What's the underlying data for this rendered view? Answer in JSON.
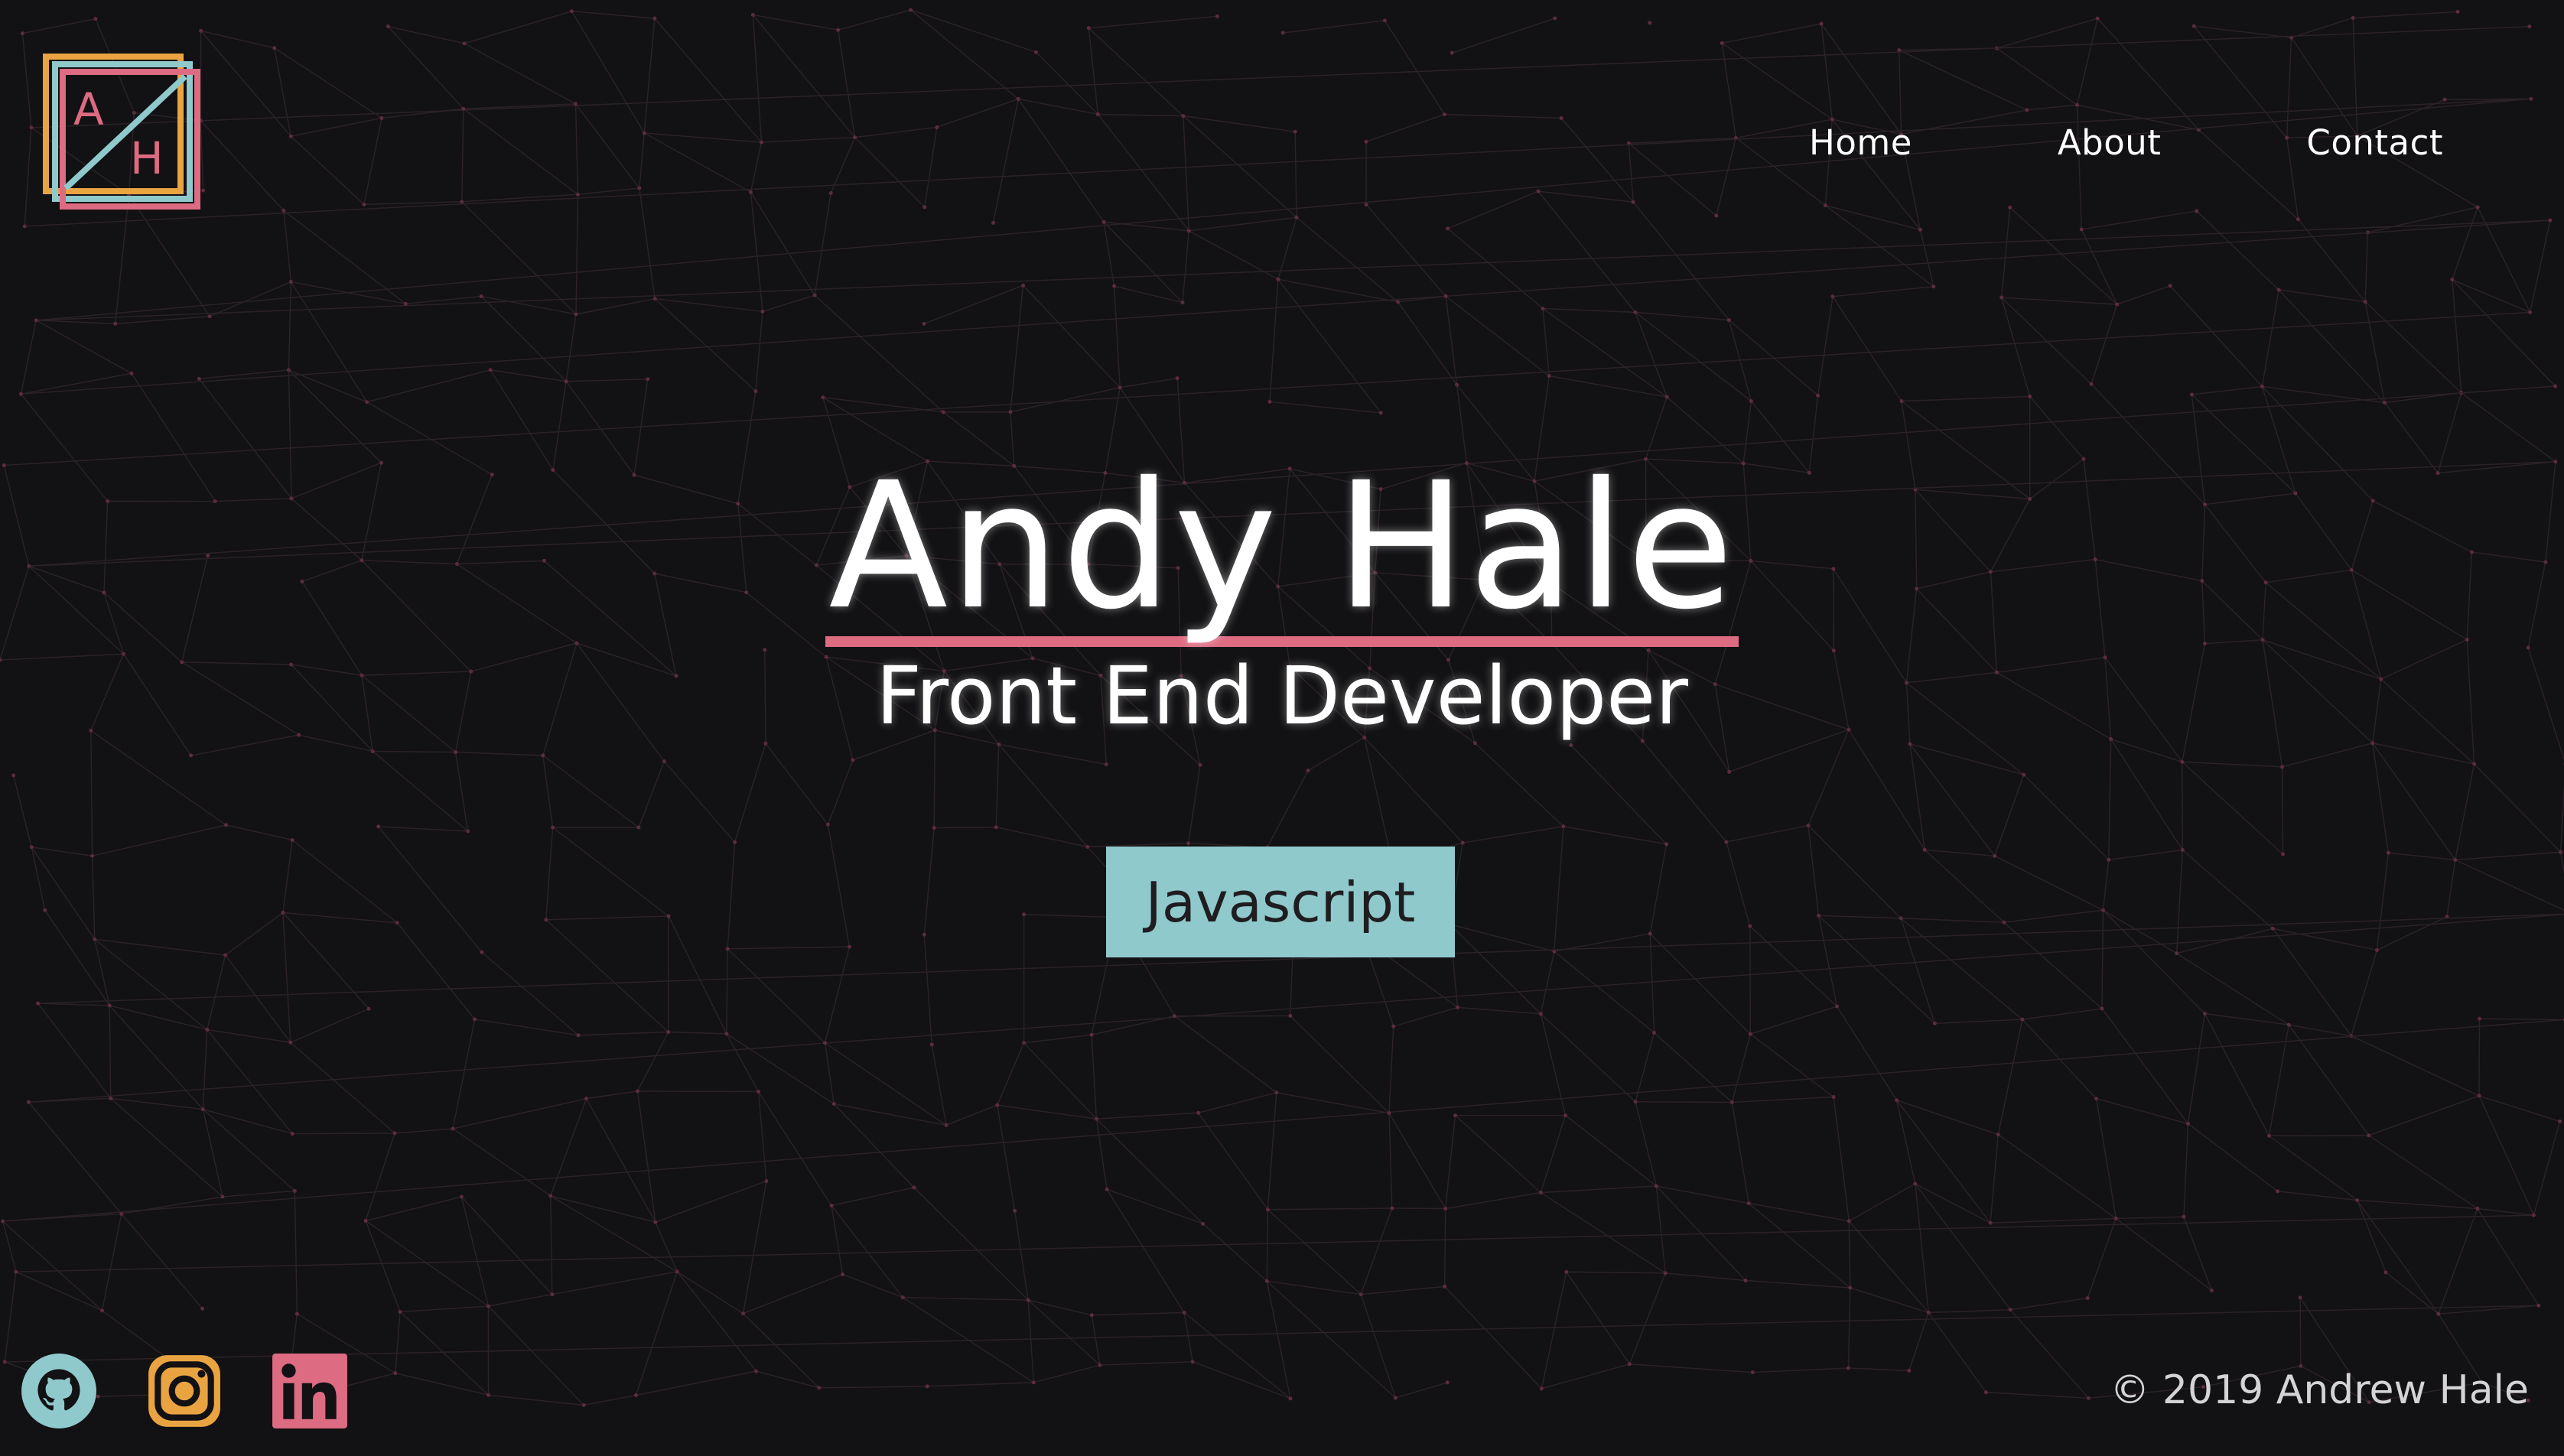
{
  "logo": {
    "letter_top": "A",
    "letter_bottom": "H",
    "colors": {
      "orange": "#e9a441",
      "pink": "#dd6b82",
      "teal": "#8fc9cc"
    }
  },
  "nav": {
    "items": [
      {
        "label": "Home"
      },
      {
        "label": "About"
      },
      {
        "label": "Contact"
      }
    ]
  },
  "hero": {
    "name": "Andy Hale",
    "title": "Front End Developer",
    "skill": "Javascript"
  },
  "social": {
    "icons": [
      "github-icon",
      "instagram-icon",
      "linkedin-icon"
    ],
    "colors": {
      "github": "#8fc9cc",
      "instagram": "#e9a441",
      "linkedin": "#dd6b82"
    }
  },
  "footer": {
    "copyright": "© 2019 Andrew Hale"
  },
  "theme": {
    "background": "#121113",
    "accent_pink": "#dd6b82",
    "accent_teal": "#8fc9cc",
    "accent_orange": "#e9a441"
  }
}
